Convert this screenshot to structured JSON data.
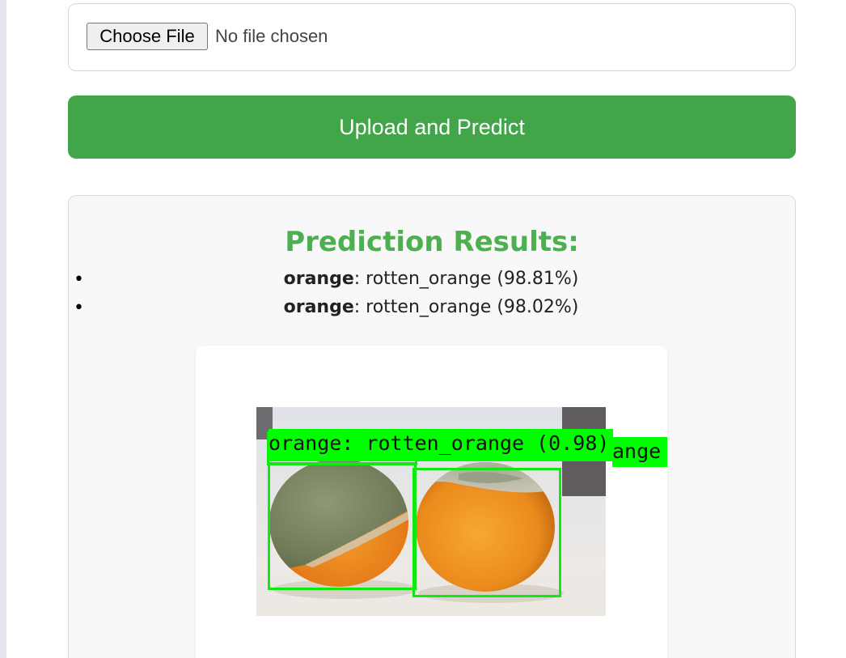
{
  "upload": {
    "choose_file_label": "Choose File",
    "file_status": "No file chosen",
    "submit_label": "Upload and Predict"
  },
  "results": {
    "title": "Prediction Results:",
    "predictions": [
      {
        "label": "orange",
        "separator": ": ",
        "text": "rotten_orange (98.81%)"
      },
      {
        "label": "orange",
        "separator": ": ",
        "text": "rotten_orange (98.02%)"
      }
    ]
  },
  "annotated_image": {
    "label_primary": "orange: rotten_orange (0.98)",
    "label_secondary_visible": "ange"
  },
  "colors": {
    "accent_green": "#43a54a",
    "title_green": "#4caf50",
    "detection_green": "#00ff00"
  }
}
